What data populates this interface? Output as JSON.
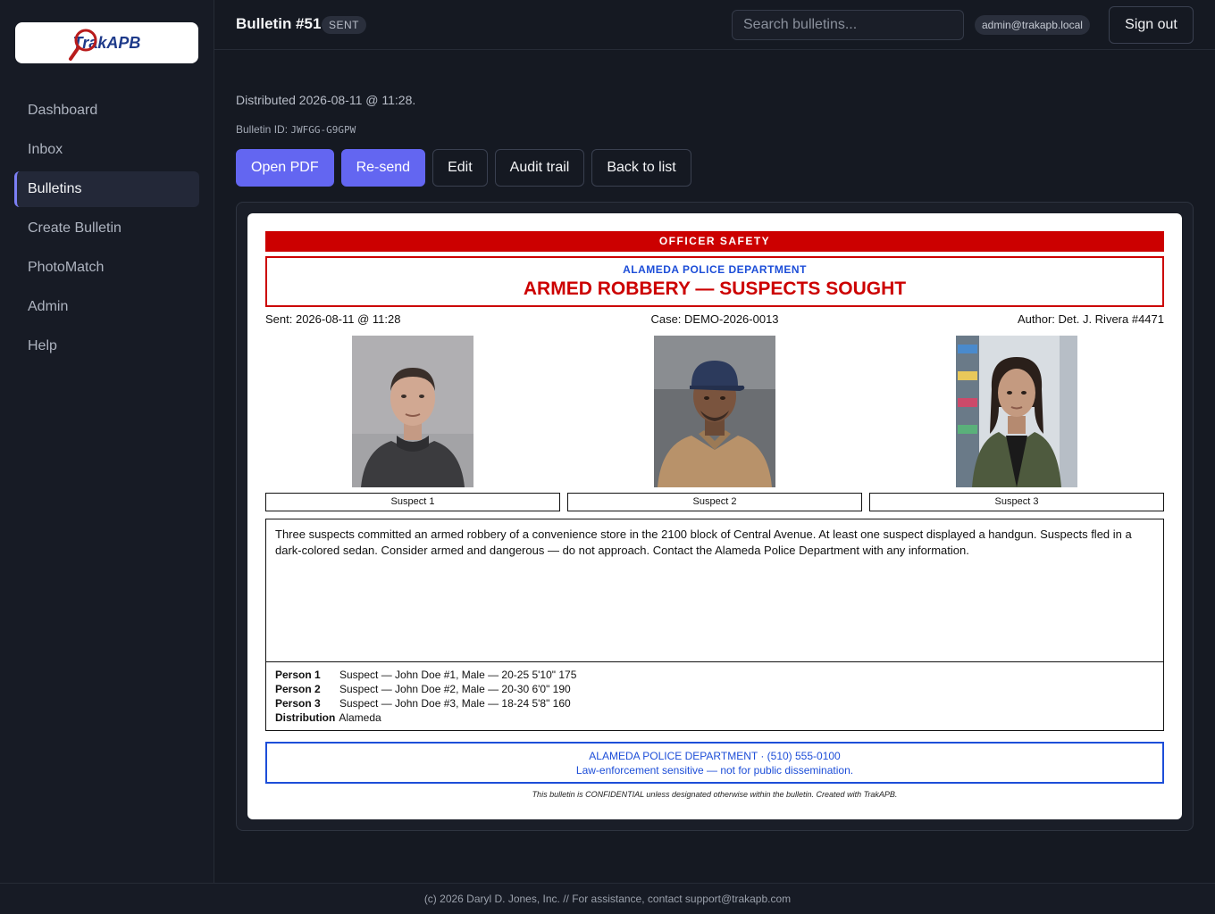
{
  "app": {
    "logo_text": "TrakAPB",
    "footer": "(c) 2026 Daryl D. Jones, Inc. // For assistance, contact support@trakapb.com"
  },
  "sidebar": {
    "items": [
      {
        "label": "Dashboard",
        "active": false
      },
      {
        "label": "Inbox",
        "active": false
      },
      {
        "label": "Bulletins",
        "active": true
      },
      {
        "label": "Create Bulletin",
        "active": false
      },
      {
        "label": "PhotoMatch",
        "active": false
      },
      {
        "label": "Admin",
        "active": false
      },
      {
        "label": "Help",
        "active": false
      }
    ]
  },
  "header": {
    "title": "Bulletin #51",
    "status": "SENT",
    "search_placeholder": "Search bulletins...",
    "user": "admin@trakapb.local",
    "signout_label": "Sign out"
  },
  "meta": {
    "distributed": "Distributed 2026-08-11 @ 11:28.",
    "id_label": "Bulletin ID:",
    "id_value": "JWFGG-G9GPW"
  },
  "actions": {
    "open_pdf": "Open PDF",
    "resend": "Re-send",
    "edit": "Edit",
    "audit": "Audit trail",
    "back": "Back to list"
  },
  "bulletin": {
    "banner": "OFFICER SAFETY",
    "department": "ALAMEDA POLICE DEPARTMENT",
    "title": "ARMED ROBBERY — SUSPECTS SOUGHT",
    "sent": "Sent:  2026-08-11 @ 11:28",
    "case": "Case: DEMO-2026-0013",
    "author": "Author:  Det. J. Rivera #4471",
    "suspects": [
      {
        "caption": "Suspect 1"
      },
      {
        "caption": "Suspect 2"
      },
      {
        "caption": "Suspect 3"
      }
    ],
    "narrative": "Three suspects committed an armed robbery of a convenience store in the 2100 block of Central Avenue. At least one suspect displayed a handgun. Suspects fled in a dark-colored sedan. Consider armed and dangerous — do not approach. Contact the Alameda Police Department with any information.",
    "persons": [
      {
        "label": "Person 1",
        "value": "Suspect — John Doe #1, Male — 20-25 5'10\" 175"
      },
      {
        "label": "Person 2",
        "value": "Suspect — John Doe #2, Male — 20-30 6'0\" 190"
      },
      {
        "label": "Person 3",
        "value": "Suspect — John Doe #3, Male — 18-24 5'8\" 160"
      }
    ],
    "distribution_label": "Distribution",
    "distribution_value": "Alameda",
    "footer_line1": "ALAMEDA POLICE DEPARTMENT · (510) 555-0100",
    "footer_line2": "Law-enforcement sensitive — not for public dissemination.",
    "confidential": "This bulletin is CONFIDENTIAL unless designated otherwise within the bulletin.   Created with TrakAPB."
  },
  "colors": {
    "accent": "#6366f1",
    "alert_red": "#cc0000",
    "dept_blue": "#1d4ed8"
  }
}
